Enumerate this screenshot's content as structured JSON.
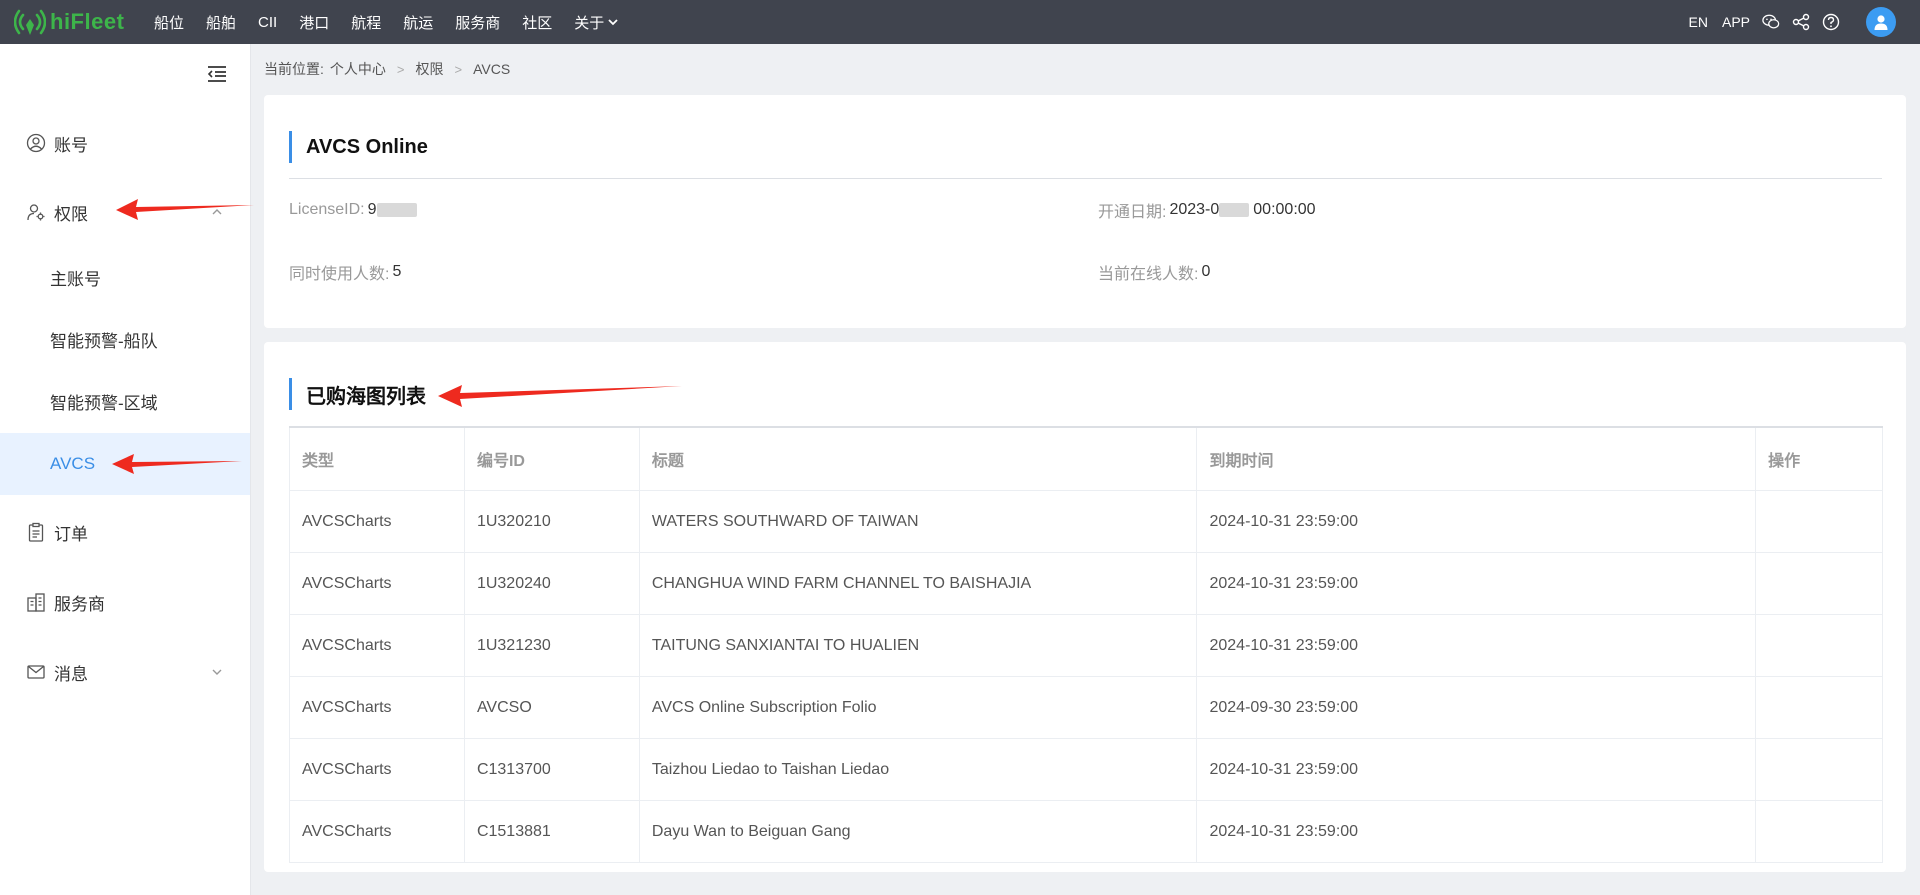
{
  "brand": {
    "name": "hiFleet"
  },
  "nav": {
    "items": [
      "船位",
      "船舶",
      "CII",
      "港口",
      "航程",
      "航运",
      "服务商",
      "社区"
    ],
    "about": "关于"
  },
  "topbar_right": {
    "lang": "EN",
    "app": "APP"
  },
  "sidebar": {
    "account": "账号",
    "permission": "权限",
    "sub_items": [
      "主账号",
      "智能预警-船队",
      "智能预警-区域",
      "AVCS"
    ],
    "orders": "订单",
    "service": "服务商",
    "messages": "消息"
  },
  "breadcrumb": {
    "prefix": "当前位置:",
    "items": [
      "个人中心",
      "权限",
      "AVCS"
    ]
  },
  "license_card": {
    "title": "AVCS Online",
    "license_label": "LicenseID:",
    "license_value": "9",
    "open_date_label": "开通日期:",
    "open_date_prefix": "2023-0",
    "open_date_suffix": "00:00:00",
    "concurrent_label": "同时使用人数:",
    "concurrent_value": "5",
    "online_label": "当前在线人数:",
    "online_value": "0"
  },
  "charts_card": {
    "title": "已购海图列表",
    "columns": [
      "类型",
      "编号ID",
      "标题",
      "到期时间",
      "操作"
    ],
    "rows": [
      [
        "AVCSCharts",
        "1U320210",
        "WATERS SOUTHWARD OF TAIWAN",
        "2024-10-31 23:59:00",
        ""
      ],
      [
        "AVCSCharts",
        "1U320240",
        "CHANGHUA WIND FARM CHANNEL TO BAISHAJIA",
        "2024-10-31 23:59:00",
        ""
      ],
      [
        "AVCSCharts",
        "1U321230",
        "TAITUNG SANXIANTAI TO HUALIEN",
        "2024-10-31 23:59:00",
        ""
      ],
      [
        "AVCSCharts",
        "AVCSO",
        "AVCS Online Subscription Folio",
        "2024-09-30 23:59:00",
        ""
      ],
      [
        "AVCSCharts",
        "C1313700",
        "Taizhou Liedao to Taishan Liedao",
        "2024-10-31 23:59:00",
        ""
      ],
      [
        "AVCSCharts",
        "C1513881",
        "Dayu Wan to Beiguan Gang",
        "2024-10-31 23:59:00",
        ""
      ]
    ]
  },
  "colors": {
    "topbar": "#40444e",
    "brand_green": "#3db54a",
    "accent_blue": "#3a8ee6",
    "active_bg": "#e8f2ff",
    "annotation_red": "#ee2a1f"
  },
  "icons": {
    "account": "user-circle-icon",
    "permission": "user-gear-icon",
    "orders": "clipboard-icon",
    "service": "building-icon",
    "messages": "mail-icon",
    "collapse": "menu-fold-icon",
    "wechat": "wechat-icon",
    "share": "share-icon",
    "help": "help-icon"
  }
}
